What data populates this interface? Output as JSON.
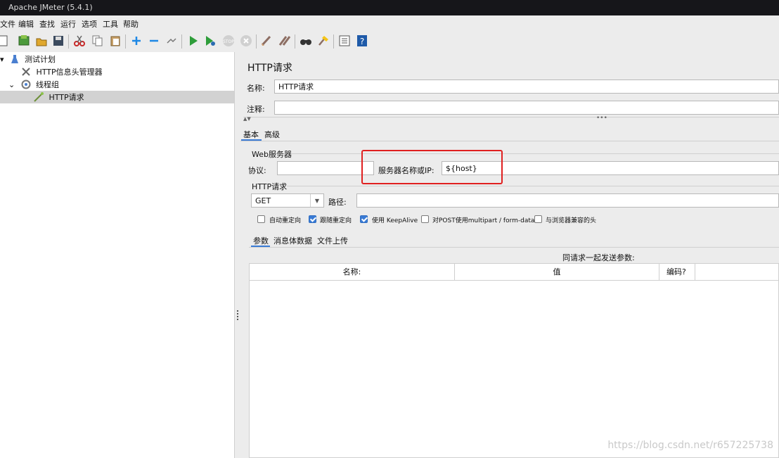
{
  "window": {
    "title": "Apache JMeter (5.4.1)"
  },
  "menu": [
    "文件",
    "编辑",
    "查找",
    "运行",
    "选项",
    "工具",
    "帮助"
  ],
  "toolbar": {
    "icons": [
      "new-icon",
      "templates-icon",
      "open-icon",
      "save-icon",
      "cut-icon",
      "copy-icon",
      "paste-icon",
      "expand-icon",
      "collapse-icon",
      "toggle-icon",
      "start-icon",
      "start-no-pause-icon",
      "stop-icon",
      "shutdown-icon",
      "clear-icon",
      "clear-all-icon",
      "search-icon",
      "reset-search-icon",
      "function-helper-icon",
      "help-icon"
    ]
  },
  "tree": {
    "items": [
      {
        "label": "测试计划",
        "icon": "test-plan-icon"
      },
      {
        "label": "HTTP信息头管理器",
        "icon": "header-manager-icon"
      },
      {
        "label": "线程组",
        "icon": "thread-group-icon"
      },
      {
        "label": "HTTP请求",
        "icon": "http-sampler-icon",
        "selected": true
      }
    ]
  },
  "panel": {
    "title": "HTTP请求",
    "name_label": "名称:",
    "name_value": "HTTP请求",
    "comment_label": "注释:",
    "comment_value": "",
    "tabs": [
      "基本",
      "高级"
    ],
    "web_server": {
      "group_label": "Web服务器",
      "protocol_label": "协议:",
      "protocol_value": "",
      "server_label": "服务器名称或IP:",
      "server_value": "${host}"
    },
    "http_request": {
      "group_label": "HTTP请求",
      "method": "GET",
      "path_label": "路径:",
      "path_value": "",
      "checkboxes": [
        {
          "label": "自动重定向",
          "checked": false
        },
        {
          "label": "跟随重定向",
          "checked": true
        },
        {
          "label": "使用 KeepAlive",
          "checked": true
        },
        {
          "label": "对POST使用multipart / form-data",
          "checked": false
        },
        {
          "label": "与浏览器兼容的头",
          "checked": false
        }
      ]
    },
    "sub_tabs": [
      "参数",
      "消息体数据",
      "文件上传"
    ],
    "params": {
      "caption": "同请求一起发送参数:",
      "columns": [
        "名称:",
        "值",
        "编码?"
      ]
    }
  },
  "watermark": "https://blog.csdn.net/r657225738",
  "colors": {
    "highlight_box": "#e02020",
    "selected_tab_underline": "#3a7bd5",
    "titlebar": "#16161a"
  }
}
